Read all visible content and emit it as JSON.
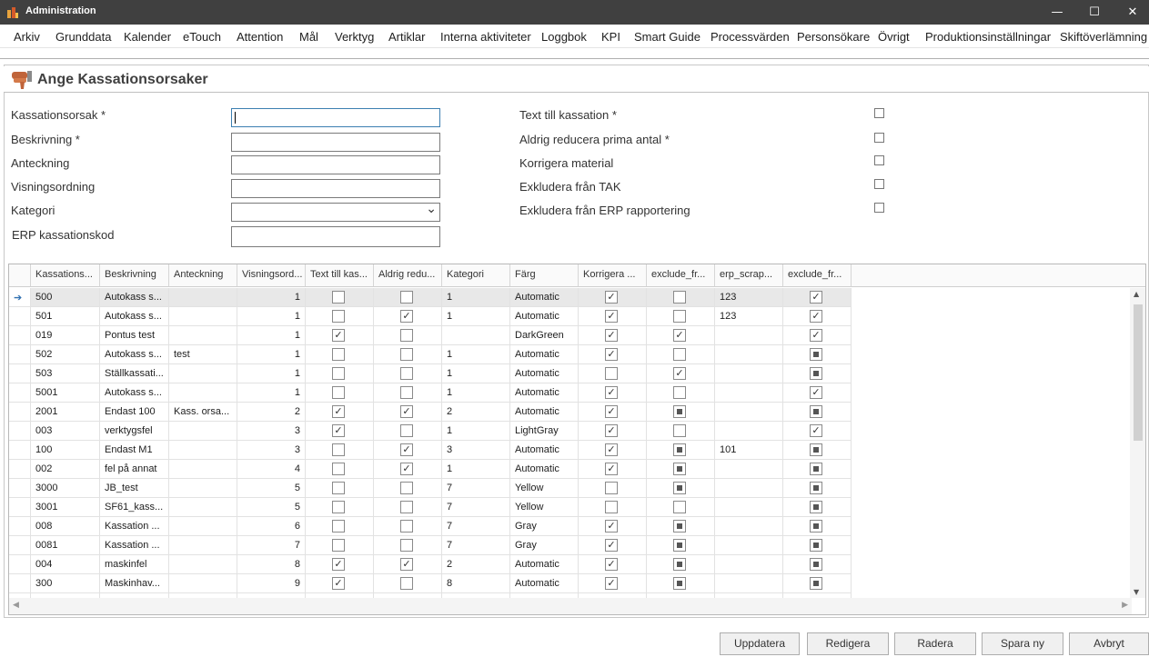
{
  "window": {
    "title": "Administration",
    "min": "—",
    "max": "☐",
    "close": "✕"
  },
  "menu": [
    "Arkiv",
    "Grunddata",
    "Kalender",
    "eTouch",
    "Attention",
    "Mål",
    "Verktyg",
    "Artiklar",
    "Interna aktiviteter",
    "Loggbok",
    "KPI",
    "Smart Guide",
    "Processvärden",
    "Personsökare",
    "Övrigt",
    "Produktionsinställningar",
    "Skiftöverlämning"
  ],
  "header": {
    "title": "Ange Kassationsorsaker"
  },
  "form": {
    "left": [
      {
        "label": "Kassationsorsak *",
        "value": ""
      },
      {
        "label": "Beskrivning *",
        "value": ""
      },
      {
        "label": "Anteckning",
        "value": ""
      },
      {
        "label": "Visningsordning",
        "value": ""
      },
      {
        "label": "Kategori",
        "value": ""
      },
      {
        "label": "ERP kassationskod",
        "value": ""
      }
    ],
    "right": [
      {
        "label": "Text till kassation *",
        "checked": false
      },
      {
        "label": "Aldrig reducera prima antal *",
        "checked": false
      },
      {
        "label": "Korrigera material",
        "checked": false
      },
      {
        "label": "Exkludera från TAK",
        "checked": false
      },
      {
        "label": "Exkludera från ERP rapportering",
        "checked": false
      }
    ]
  },
  "grid": {
    "columns": [
      "Kassations...",
      "Beskrivning",
      "Anteckning",
      "Visningsord...",
      "Text till kas...",
      "Aldrig redu...",
      "Kategori",
      "Färg",
      "Korrigera ...",
      "exclude_fr...",
      "erp_scrap...",
      "exclude_fr..."
    ],
    "current_row_marker": "➔",
    "rows": [
      {
        "kod": "500",
        "besk": "Autokass s...",
        "ant": "",
        "vis": "1",
        "text": "0",
        "aldrig": "0",
        "kat": "1",
        "farg": "Automatic",
        "korr": "1",
        "excl": "0",
        "erp": "123",
        "excl2": "1"
      },
      {
        "kod": "501",
        "besk": "Autokass s...",
        "ant": "",
        "vis": "1",
        "text": "0",
        "aldrig": "1",
        "kat": "1",
        "farg": "Automatic",
        "korr": "1",
        "excl": "0",
        "erp": "123",
        "excl2": "1"
      },
      {
        "kod": "019",
        "besk": "Pontus test",
        "ant": "",
        "vis": "1",
        "text": "1",
        "aldrig": "0",
        "kat": "",
        "farg": "DarkGreen",
        "korr": "1",
        "excl": "1",
        "erp": "",
        "excl2": "1"
      },
      {
        "kod": "502",
        "besk": "Autokass s...",
        "ant": "test",
        "vis": "1",
        "text": "0",
        "aldrig": "0",
        "kat": "1",
        "farg": "Automatic",
        "korr": "1",
        "excl": "0",
        "erp": "",
        "excl2": "i"
      },
      {
        "kod": "503",
        "besk": "Ställkassati...",
        "ant": "",
        "vis": "1",
        "text": "0",
        "aldrig": "0",
        "kat": "1",
        "farg": "Automatic",
        "korr": "0",
        "excl": "1",
        "erp": "",
        "excl2": "i"
      },
      {
        "kod": "5001",
        "besk": "Autokass s...",
        "ant": "",
        "vis": "1",
        "text": "0",
        "aldrig": "0",
        "kat": "1",
        "farg": "Automatic",
        "korr": "1",
        "excl": "0",
        "erp": "",
        "excl2": "1"
      },
      {
        "kod": "2001",
        "besk": "Endast 100",
        "ant": "Kass. orsa...",
        "vis": "2",
        "text": "1",
        "aldrig": "1",
        "kat": "2",
        "farg": "Automatic",
        "korr": "1",
        "excl": "i",
        "erp": "",
        "excl2": "i"
      },
      {
        "kod": "003",
        "besk": "verktygsfel",
        "ant": "",
        "vis": "3",
        "text": "1",
        "aldrig": "0",
        "kat": "1",
        "farg": "LightGray",
        "korr": "1",
        "excl": "0",
        "erp": "",
        "excl2": "1"
      },
      {
        "kod": "100",
        "besk": "Endast M1",
        "ant": "",
        "vis": "3",
        "text": "0",
        "aldrig": "1",
        "kat": "3",
        "farg": "Automatic",
        "korr": "1",
        "excl": "i",
        "erp": "101",
        "excl2": "i"
      },
      {
        "kod": "002",
        "besk": "fel på annat",
        "ant": "",
        "vis": "4",
        "text": "0",
        "aldrig": "1",
        "kat": "1",
        "farg": "Automatic",
        "korr": "1",
        "excl": "i",
        "erp": "",
        "excl2": "i"
      },
      {
        "kod": "3000",
        "besk": "JB_test",
        "ant": "",
        "vis": "5",
        "text": "0",
        "aldrig": "0",
        "kat": "7",
        "farg": "Yellow",
        "korr": "0",
        "excl": "i",
        "erp": "",
        "excl2": "i"
      },
      {
        "kod": "3001",
        "besk": "SF61_kass...",
        "ant": "",
        "vis": "5",
        "text": "0",
        "aldrig": "0",
        "kat": "7",
        "farg": "Yellow",
        "korr": "0",
        "excl": "0",
        "erp": "",
        "excl2": "i"
      },
      {
        "kod": "008",
        "besk": "Kassation ...",
        "ant": "",
        "vis": "6",
        "text": "0",
        "aldrig": "0",
        "kat": "7",
        "farg": "Gray",
        "korr": "1",
        "excl": "i",
        "erp": "",
        "excl2": "i"
      },
      {
        "kod": "0081",
        "besk": "Kassation ...",
        "ant": "",
        "vis": "7",
        "text": "0",
        "aldrig": "0",
        "kat": "7",
        "farg": "Gray",
        "korr": "1",
        "excl": "i",
        "erp": "",
        "excl2": "i"
      },
      {
        "kod": "004",
        "besk": "maskinfel",
        "ant": "",
        "vis": "8",
        "text": "1",
        "aldrig": "1",
        "kat": "2",
        "farg": "Automatic",
        "korr": "1",
        "excl": "i",
        "erp": "",
        "excl2": "i"
      },
      {
        "kod": "300",
        "besk": "Maskinhav...",
        "ant": "",
        "vis": "9",
        "text": "1",
        "aldrig": "0",
        "kat": "8",
        "farg": "Automatic",
        "korr": "1",
        "excl": "i",
        "erp": "",
        "excl2": "i"
      }
    ]
  },
  "buttons": [
    "Uppdatera",
    "Redigera",
    "Radera",
    "Spara ny",
    "Avbryt"
  ]
}
